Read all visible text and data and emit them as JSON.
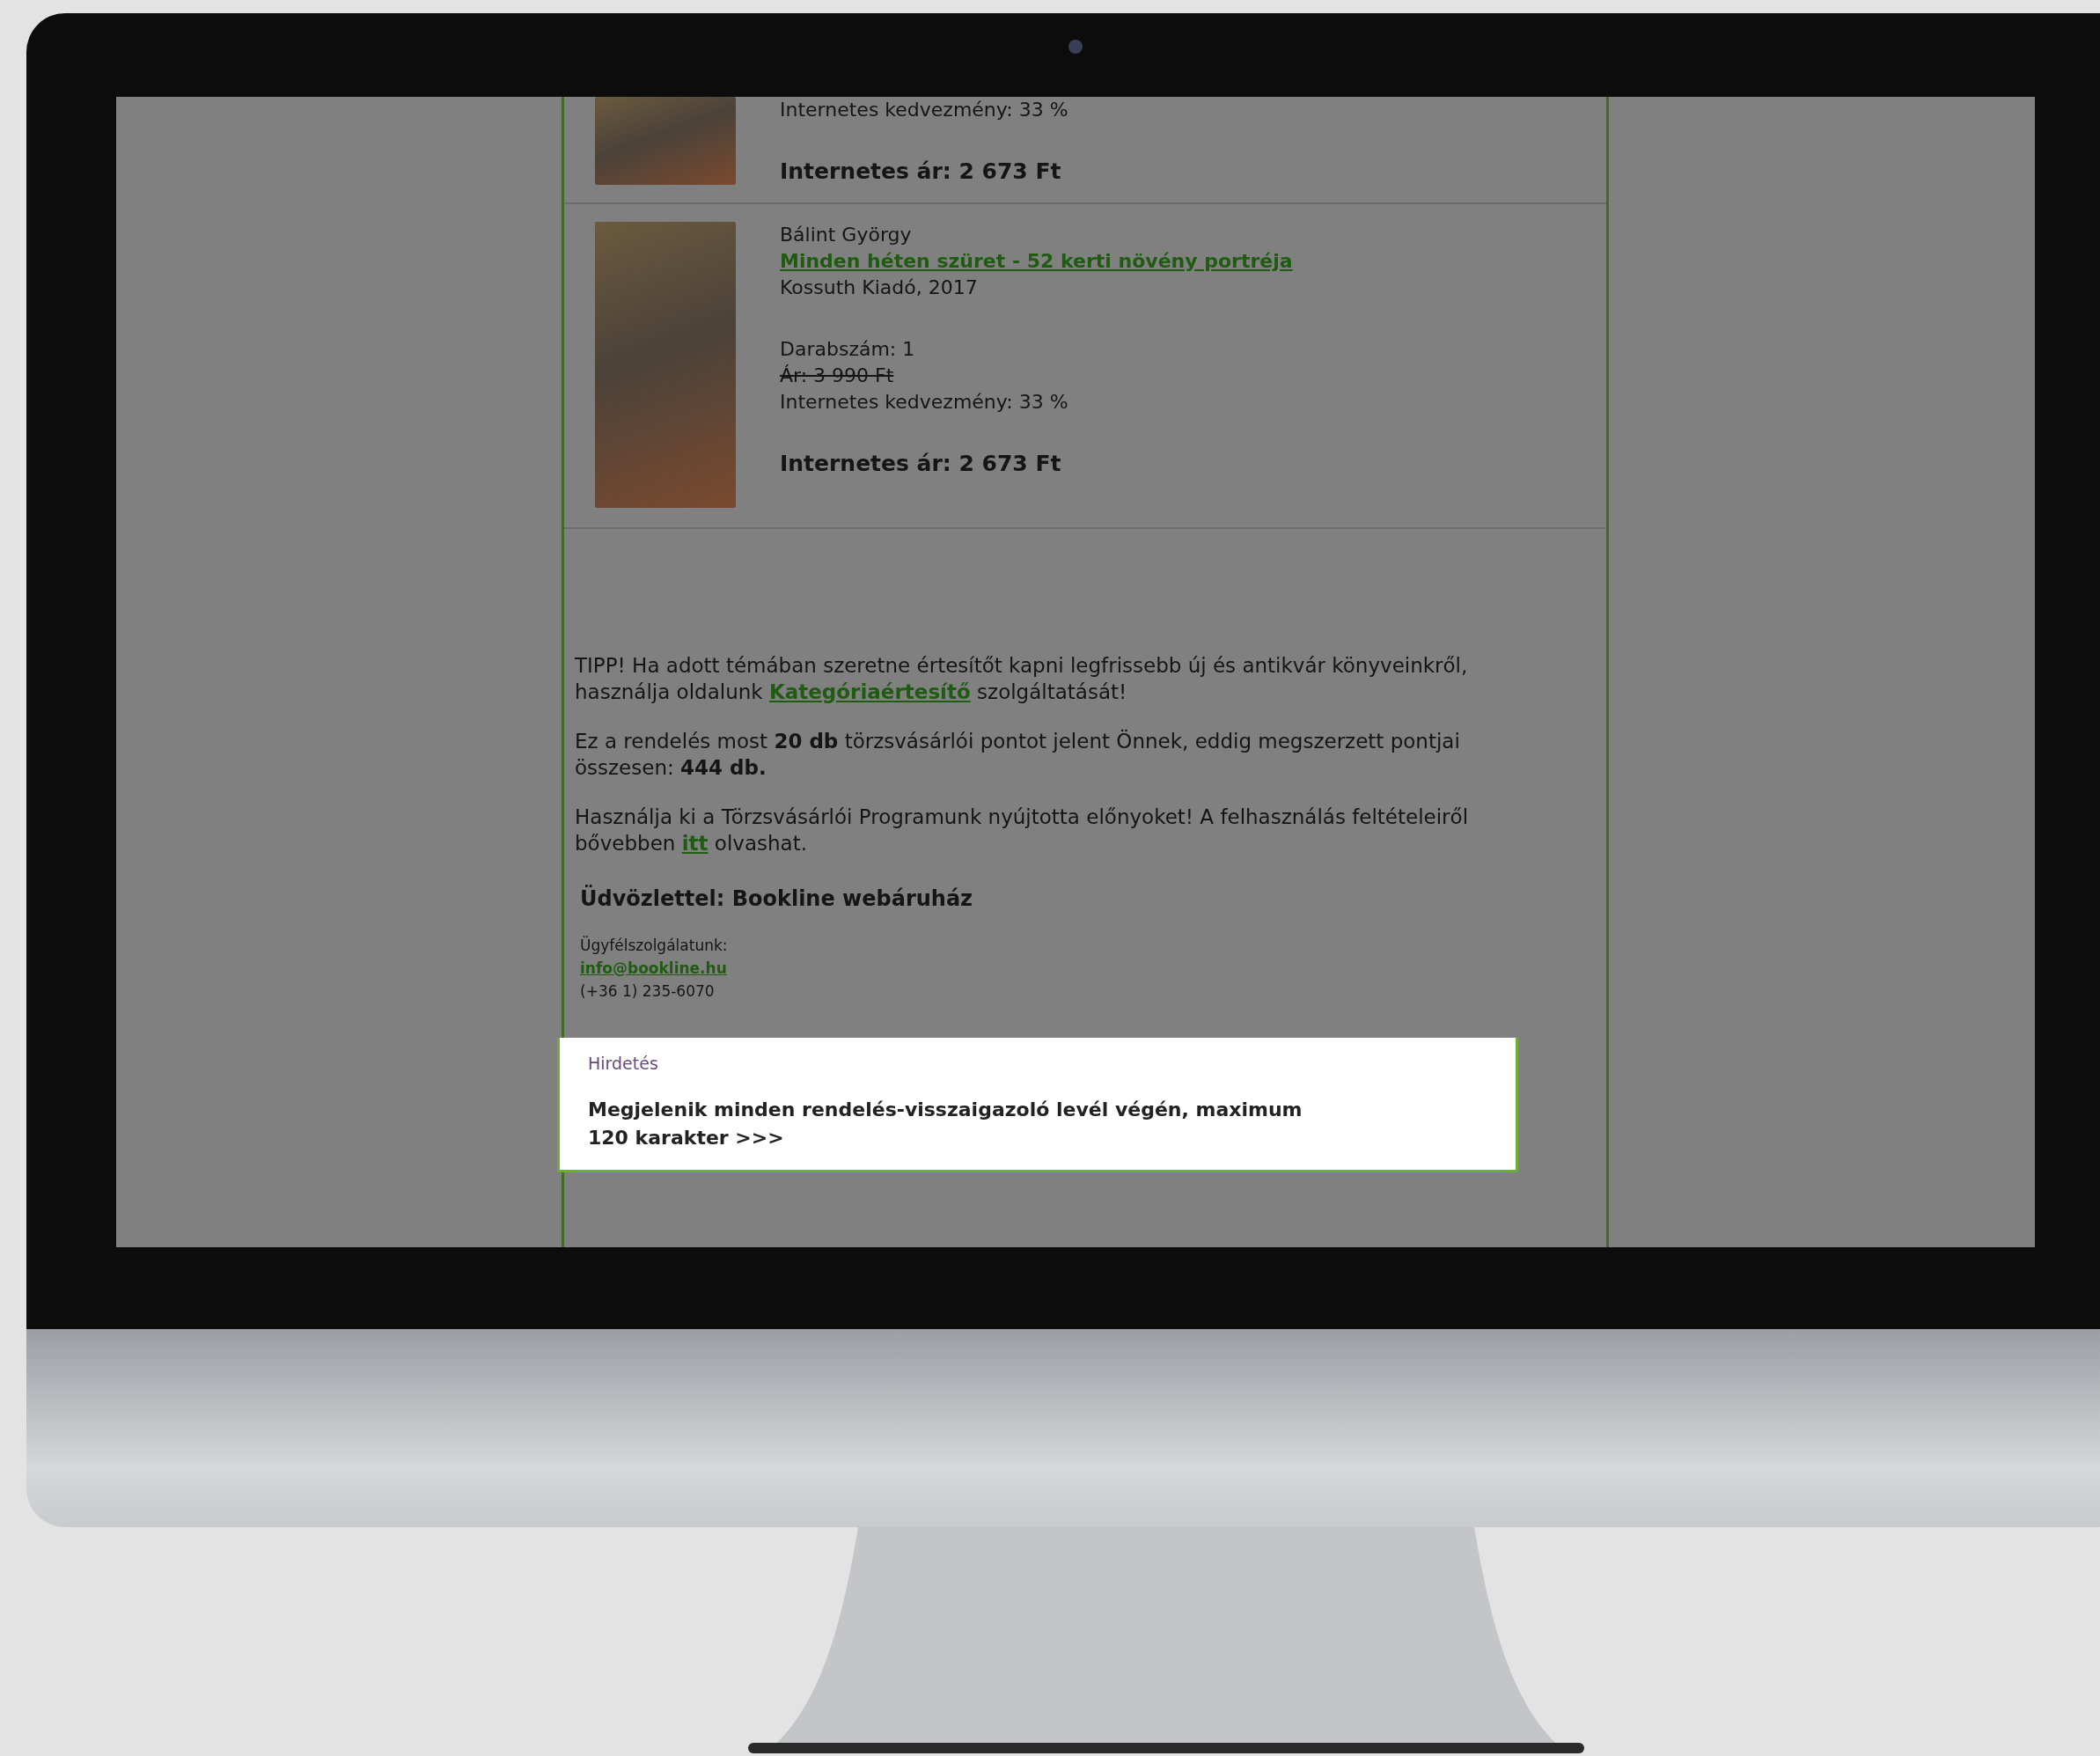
{
  "email": {
    "products": [
      {
        "kind": "partial",
        "discount": "Internetes kedvezmény: 33 %",
        "price": "Internetes ár: 2 673 Ft"
      },
      {
        "kind": "full",
        "author": "Bálint György",
        "title": "Minden héten szüret - 52 kerti növény portréja",
        "publisher": "Kossuth Kiadó, 2017",
        "quantity": "Darabszám: 1",
        "old_price": "Ár: 3 990 Ft",
        "discount": "Internetes kedvezmény: 33 %",
        "price": "Internetes ár: 2 673 Ft"
      }
    ],
    "tip": {
      "before": "TIPP! Ha adott témában szeretne értesítőt kapni legfrissebb új és antikvár könyveinkről, használja oldalunk ",
      "link": "Kategóriaértesítő",
      "after": " szolgáltatását!"
    },
    "points": "Ez a rendelés most **20 db** törzsvásárlói pontot jelent Önnek, eddig megszerzett pontjai összesen: **444 db.**",
    "program": {
      "before": "Használja ki a Törzsvásárlói Programunk nyújtotta előnyoket! A felhasználás feltételeiről bővebben ",
      "link": "itt",
      "after": " olvashat."
    },
    "signature": "Üdvözlettel: Bookline webáruház",
    "contact": {
      "label": "Ügyfélszolgálatunk:",
      "email": "info@bookline.hu",
      "phone": "(+36 1) 235-6070"
    },
    "ad": {
      "highlighted": true,
      "label": "Hirdetés",
      "text": "Megjelenik minden rendelés-visszaigazoló levél végén, maximum 120 karakter >>>"
    }
  }
}
